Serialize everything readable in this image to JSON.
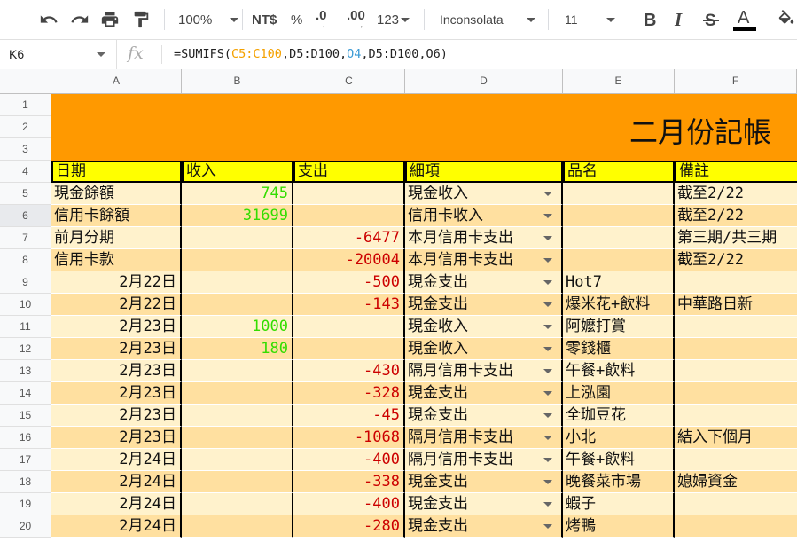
{
  "toolbar": {
    "zoom": "100%",
    "currency": "NT$",
    "percent": "%",
    "decrease_decimal": ".0",
    "increase_decimal": ".00",
    "number_format": "123",
    "font": "Inconsolata",
    "font_size": "11"
  },
  "formula_bar": {
    "cell_ref": "K6",
    "fx": "fx",
    "formula_parts": [
      {
        "text": "=SUMIFS(",
        "color": "#222222"
      },
      {
        "text": "C5:C100",
        "color": "#f4a100"
      },
      {
        "text": ",D5:D100,",
        "color": "#222222"
      },
      {
        "text": "O4",
        "color": "#3c9bd5"
      },
      {
        "text": ",D5:D100,",
        "color": "#222222"
      },
      {
        "text": "O6",
        "color": "#222222"
      },
      {
        "text": ")",
        "color": "#222222"
      }
    ]
  },
  "columns": [
    "A",
    "B",
    "C",
    "D",
    "E",
    "F"
  ],
  "rows": [
    "1",
    "2",
    "3",
    "4",
    "5",
    "6",
    "7",
    "8",
    "9",
    "10",
    "11",
    "12",
    "13",
    "14",
    "15",
    "16",
    "17",
    "18",
    "19",
    "20"
  ],
  "title": "二月份記帳",
  "headers": [
    "日期",
    "收入",
    "支出",
    "細項",
    "品名",
    "備註"
  ],
  "data_rows": [
    {
      "a": "現金餘額",
      "b": "745",
      "c": "",
      "d": "現金收入",
      "e": "",
      "f": "截至2/22"
    },
    {
      "a": "信用卡餘額",
      "b": "31699",
      "c": "",
      "d": "信用卡收入",
      "e": "",
      "f": "截至2/22"
    },
    {
      "a": "前月分期",
      "b": "",
      "c": "-6477",
      "d": "本月信用卡支出",
      "e": "",
      "f": "第三期/共三期"
    },
    {
      "a": "信用卡款",
      "b": "",
      "c": "-20004",
      "d": "本月信用卡支出",
      "e": "",
      "f": "截至2/22"
    },
    {
      "a": "2月22日",
      "b": "",
      "c": "-500",
      "d": "現金支出",
      "e": "Hot7",
      "f": ""
    },
    {
      "a": "2月22日",
      "b": "",
      "c": "-143",
      "d": "現金支出",
      "e": "爆米花+飲料",
      "f": "中華路日新"
    },
    {
      "a": "2月23日",
      "b": "1000",
      "c": "",
      "d": "現金收入",
      "e": "阿嬤打賞",
      "f": ""
    },
    {
      "a": "2月23日",
      "b": "180",
      "c": "",
      "d": "現金收入",
      "e": "零錢櫃",
      "f": ""
    },
    {
      "a": "2月23日",
      "b": "",
      "c": "-430",
      "d": "隔月信用卡支出",
      "e": "午餐+飲料",
      "f": ""
    },
    {
      "a": "2月23日",
      "b": "",
      "c": "-328",
      "d": "現金支出",
      "e": "上泓園",
      "f": ""
    },
    {
      "a": "2月23日",
      "b": "",
      "c": "-45",
      "d": "現金支出",
      "e": "全珈豆花",
      "f": ""
    },
    {
      "a": "2月23日",
      "b": "",
      "c": "-1068",
      "d": "隔月信用卡支出",
      "e": "小北",
      "f": "結入下個月"
    },
    {
      "a": "2月24日",
      "b": "",
      "c": "-400",
      "d": "隔月信用卡支出",
      "e": "午餐+飲料",
      "f": ""
    },
    {
      "a": "2月24日",
      "b": "",
      "c": "-338",
      "d": "現金支出",
      "e": "晚餐菜市場",
      "f": "媳婦資金"
    },
    {
      "a": "2月24日",
      "b": "",
      "c": "-400",
      "d": "現金支出",
      "e": "蝦子",
      "f": ""
    },
    {
      "a": "2月24日",
      "b": "",
      "c": "-280",
      "d": "現金支出",
      "e": "烤鴨",
      "f": ""
    }
  ],
  "colors": {
    "banner": "#ff9900",
    "header": "#ffff00",
    "row_light": "#fff2cc",
    "row_dark": "#ffe0a0",
    "income": "#33dd00",
    "expense": "#cc0000"
  }
}
